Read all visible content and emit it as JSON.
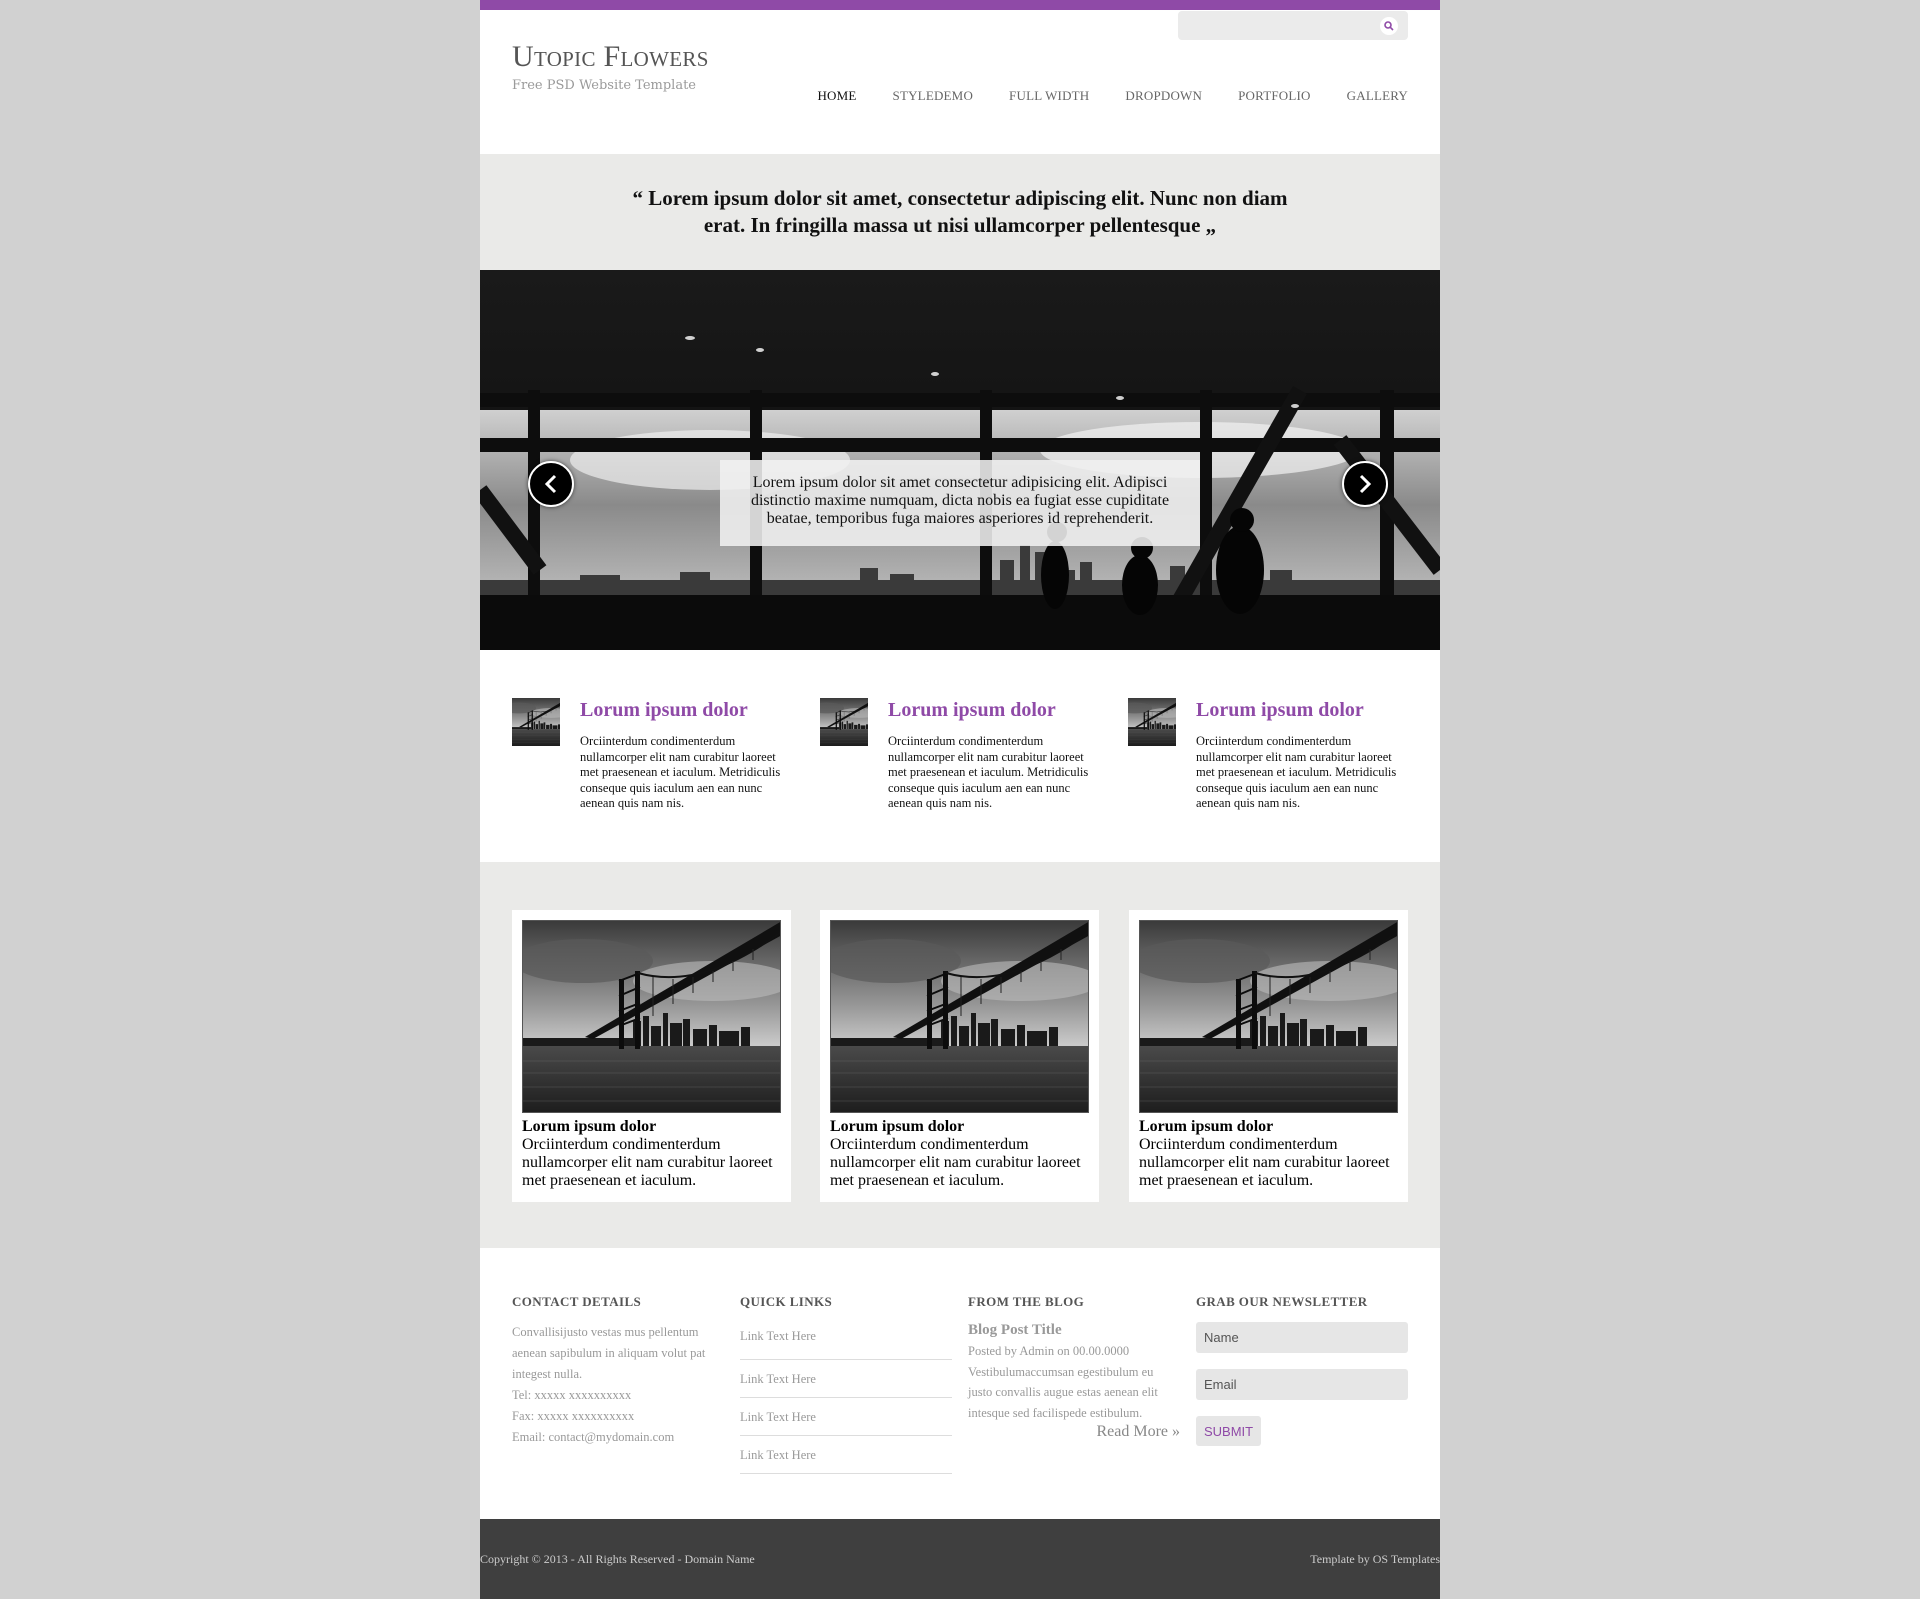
{
  "colors": {
    "accent": "#8f4aa7",
    "panel": "#eaeae8",
    "footer_bar": "#3f3f3f"
  },
  "header": {
    "logo_title": "Utopic Flowers",
    "logo_subtitle": "Free PSD Website Template",
    "search": {
      "placeholder": "",
      "icon": "search-icon"
    },
    "nav": [
      "HOME",
      "STYLEDEMO",
      "FULL WIDTH",
      "DROPDOWN",
      "PORTFOLIO",
      "GALLERY"
    ],
    "active_nav": "HOME"
  },
  "quote": "“ Lorem ipsum dolor sit amet, consectetur adipiscing elit. Nunc non diam erat. In fringilla massa ut nisi ullamcorper pellentesque „",
  "slider": {
    "caption": "Lorem ipsum dolor sit amet consectetur adipisicing elit. Adipisci distinctio maxime numquam, dicta nobis ea fugiat esse cupiditate beatae, temporibus fuga maiores asperiores id reprehenderit.",
    "prev_icon": "chevron-left-icon",
    "next_icon": "chevron-right-icon"
  },
  "features": [
    {
      "title": "Lorum ipsum dolor",
      "text": "Orciinterdum condimenterdum nullamcorper elit nam curabitur laoreet met praesenean et iaculum. Metridiculis conseque quis iaculum aen ean nunc aenean quis nam nis."
    },
    {
      "title": "Lorum ipsum dolor",
      "text": "Orciinterdum condimenterdum nullamcorper elit nam curabitur laoreet met praesenean et iaculum. Metridiculis conseque quis iaculum aen ean nunc aenean quis nam nis."
    },
    {
      "title": "Lorum ipsum dolor",
      "text": "Orciinterdum condimenterdum nullamcorper elit nam curabitur laoreet met praesenean et iaculum. Metridiculis conseque quis iaculum aen ean nunc aenean quis nam nis."
    }
  ],
  "gallery": [
    {
      "title": "Lorum ipsum dolor",
      "text": "Orciinterdum condimenterdum nullamcorper elit nam curabitur laoreet met praesenean et iaculum."
    },
    {
      "title": "Lorum ipsum dolor",
      "text": "Orciinterdum condimenterdum nullamcorper elit nam curabitur laoreet met praesenean et iaculum."
    },
    {
      "title": "Lorum ipsum dolor",
      "text": "Orciinterdum condimenterdum nullamcorper elit nam curabitur laoreet met praesenean et iaculum."
    }
  ],
  "footer": {
    "contact": {
      "heading": "CONTACT DETAILS",
      "text": "Convallisijusto vestas mus pellentum aenean sapibulum in aliquam volut pat integest nulla.",
      "tel": "Tel: xxxxx xxxxxxxxxx",
      "fax": "Fax: xxxxx xxxxxxxxxx",
      "email": "Email: contact@mydomain.com"
    },
    "quick_links": {
      "heading": "QUICK LINKS",
      "links": [
        "Link Text Here",
        "Link Text Here",
        "Link Text Here",
        "Link Text Here"
      ]
    },
    "blog": {
      "heading": "FROM THE BLOG",
      "post_title": "Blog Post Title",
      "meta": "Posted by Admin on 00.00.0000",
      "text": "Vestibulumaccumsan egestibulum eu justo convallis augue estas aenean elit intesque sed facilispede estibulum.",
      "read_more": "Read More »"
    },
    "newsletter": {
      "heading": "GRAB OUR NEWSLETTER",
      "name_placeholder": "Name",
      "email_placeholder": "Email",
      "submit_label": "SUBMIT"
    }
  },
  "bottom": {
    "copyright": "Copyright © 2013 - All Rights Reserved - Domain Name",
    "credit": "Template by OS Templates"
  }
}
